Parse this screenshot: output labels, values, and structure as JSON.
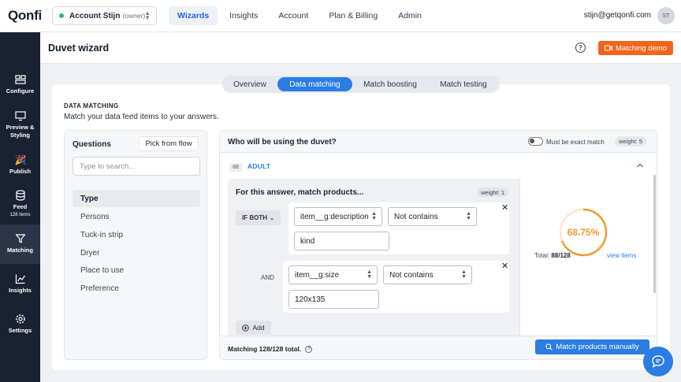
{
  "brand": {
    "logo": "Qonfi"
  },
  "account": {
    "name": "Account Stijn",
    "role": "(owner)"
  },
  "nav": {
    "items": [
      "Wizards",
      "Insights",
      "Account",
      "Plan & Billing",
      "Admin"
    ],
    "active": "Wizards"
  },
  "user": {
    "email": "stijn@getqonfi.com",
    "initials": "ST"
  },
  "sidebar": {
    "items": [
      {
        "label": "Configure",
        "sub": ""
      },
      {
        "label": "Preview &",
        "label2": "Styling",
        "sub": ""
      },
      {
        "label": "Publish",
        "sub": ""
      },
      {
        "label": "Feed",
        "sub": "128 items"
      },
      {
        "label": "Matching",
        "sub": ""
      },
      {
        "label": "Insights",
        "sub": ""
      },
      {
        "label": "Settings",
        "sub": ""
      }
    ]
  },
  "page": {
    "title": "Duvet wizard",
    "help": "?",
    "demo_button": "Matching demo"
  },
  "tabs": [
    "Overview",
    "Data matching",
    "Match boosting",
    "Match testing"
  ],
  "section": {
    "label": "DATA MATCHING",
    "description": "Match your data feed items to your answers."
  },
  "questions": {
    "title": "Questions",
    "pick_flow": "Pick from flow",
    "search_placeholder": "Type to search...",
    "items": [
      "Type",
      "Persons",
      "Tuck-in strip",
      "Dryer",
      "Place to use",
      "Preference"
    ]
  },
  "question_panel": {
    "question": "Who will be using the duvet?",
    "exact_match_label": "Must be exact match",
    "weight": "weight: 5",
    "answer_count": "88",
    "answer": "ADULT",
    "rule": {
      "title": "For this answer, match products...",
      "weight": "weight: 1",
      "operator": "IF BOTH",
      "and_label": "AND",
      "conditions": [
        {
          "field": "item__g:description",
          "comparator": "Not contains",
          "value": "kind"
        },
        {
          "field": "item__g:size",
          "comparator": "Not contains",
          "value": "120x135"
        }
      ],
      "add_label": "Add"
    },
    "stats": {
      "percent": "68.75%",
      "percent_value": 68.75,
      "total_label": "Total:",
      "total_value": "88/128",
      "view_items": "view items"
    },
    "footer": {
      "matching": "Matching 128/128 total.",
      "button": "Match products manually"
    }
  },
  "colors": {
    "accent": "#2a7de1",
    "orange": "#f1641c",
    "ring": "#f39a2e",
    "sidebar": "#1a2133"
  }
}
